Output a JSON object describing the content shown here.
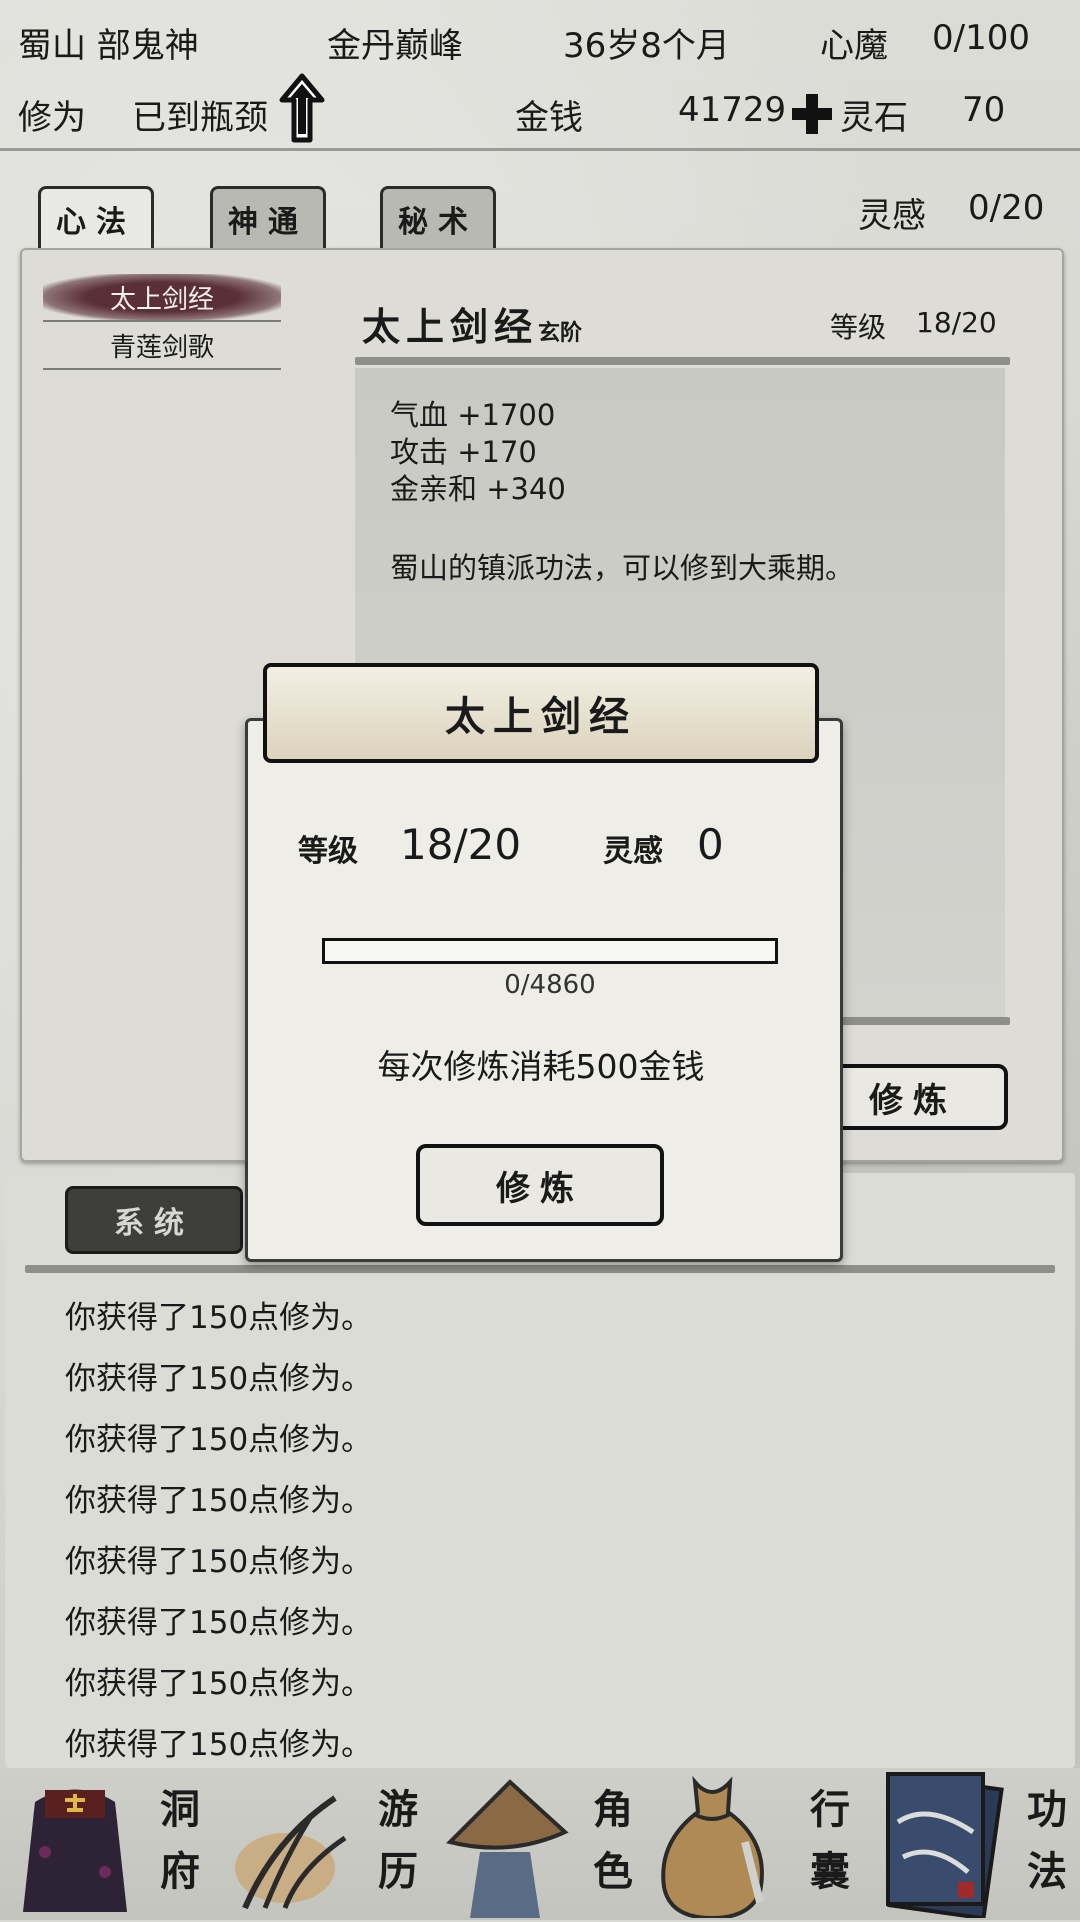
{
  "header": {
    "sect": "蜀山 部鬼神",
    "realm": "金丹巅峰",
    "age": "36岁8个月",
    "heart_demon_label": "心魔",
    "heart_demon_value": "0/100",
    "cultivation_label": "修为",
    "cultivation_value": "已到瓶颈",
    "money_label": "金钱",
    "money_value": "41729",
    "spirit_stone_label": "灵石",
    "spirit_stone_value": "70"
  },
  "tabs": [
    "心法",
    "神通",
    "秘术"
  ],
  "inspiration": {
    "label": "灵感",
    "value": "0/20"
  },
  "technique_list": [
    "太上剑经",
    "青莲剑歌"
  ],
  "detail": {
    "name": "太上剑经",
    "rank": "玄阶",
    "level_label": "等级",
    "level_value": "18/20",
    "stats": [
      "气血 +1700",
      "攻击 +170",
      "金亲和 +340"
    ],
    "description": "蜀山的镇派功法，可以修到大乘期。",
    "cultivate_button": "修炼"
  },
  "log": {
    "tab_label": "系统",
    "lines": [
      "你获得了150点修为。",
      "你获得了150点修为。",
      "你获得了150点修为。",
      "你获得了150点修为。",
      "你获得了150点修为。",
      "你获得了150点修为。",
      "你获得了150点修为。",
      "你获得了150点修为。"
    ]
  },
  "dialog": {
    "title": "太上剑经",
    "level_label": "等级",
    "level_value": "18/20",
    "inspiration_label": "灵感",
    "inspiration_value": "0",
    "progress_text": "0/4860",
    "progress_fraction": 0,
    "cost_text": "每次修炼消耗500金钱",
    "cultivate_button": "修炼"
  },
  "nav": [
    {
      "label_1": "洞",
      "label_2": "府",
      "icon": "cave-icon"
    },
    {
      "label_1": "游",
      "label_2": "历",
      "icon": "travel-icon"
    },
    {
      "label_1": "角",
      "label_2": "色",
      "icon": "character-icon"
    },
    {
      "label_1": "行",
      "label_2": "囊",
      "icon": "bag-icon"
    },
    {
      "label_1": "功",
      "label_2": "法",
      "icon": "scroll-icon"
    }
  ],
  "colors": {
    "accent": "#5a3036",
    "ink": "#1a1a1a",
    "paper": "#dddcd7"
  }
}
